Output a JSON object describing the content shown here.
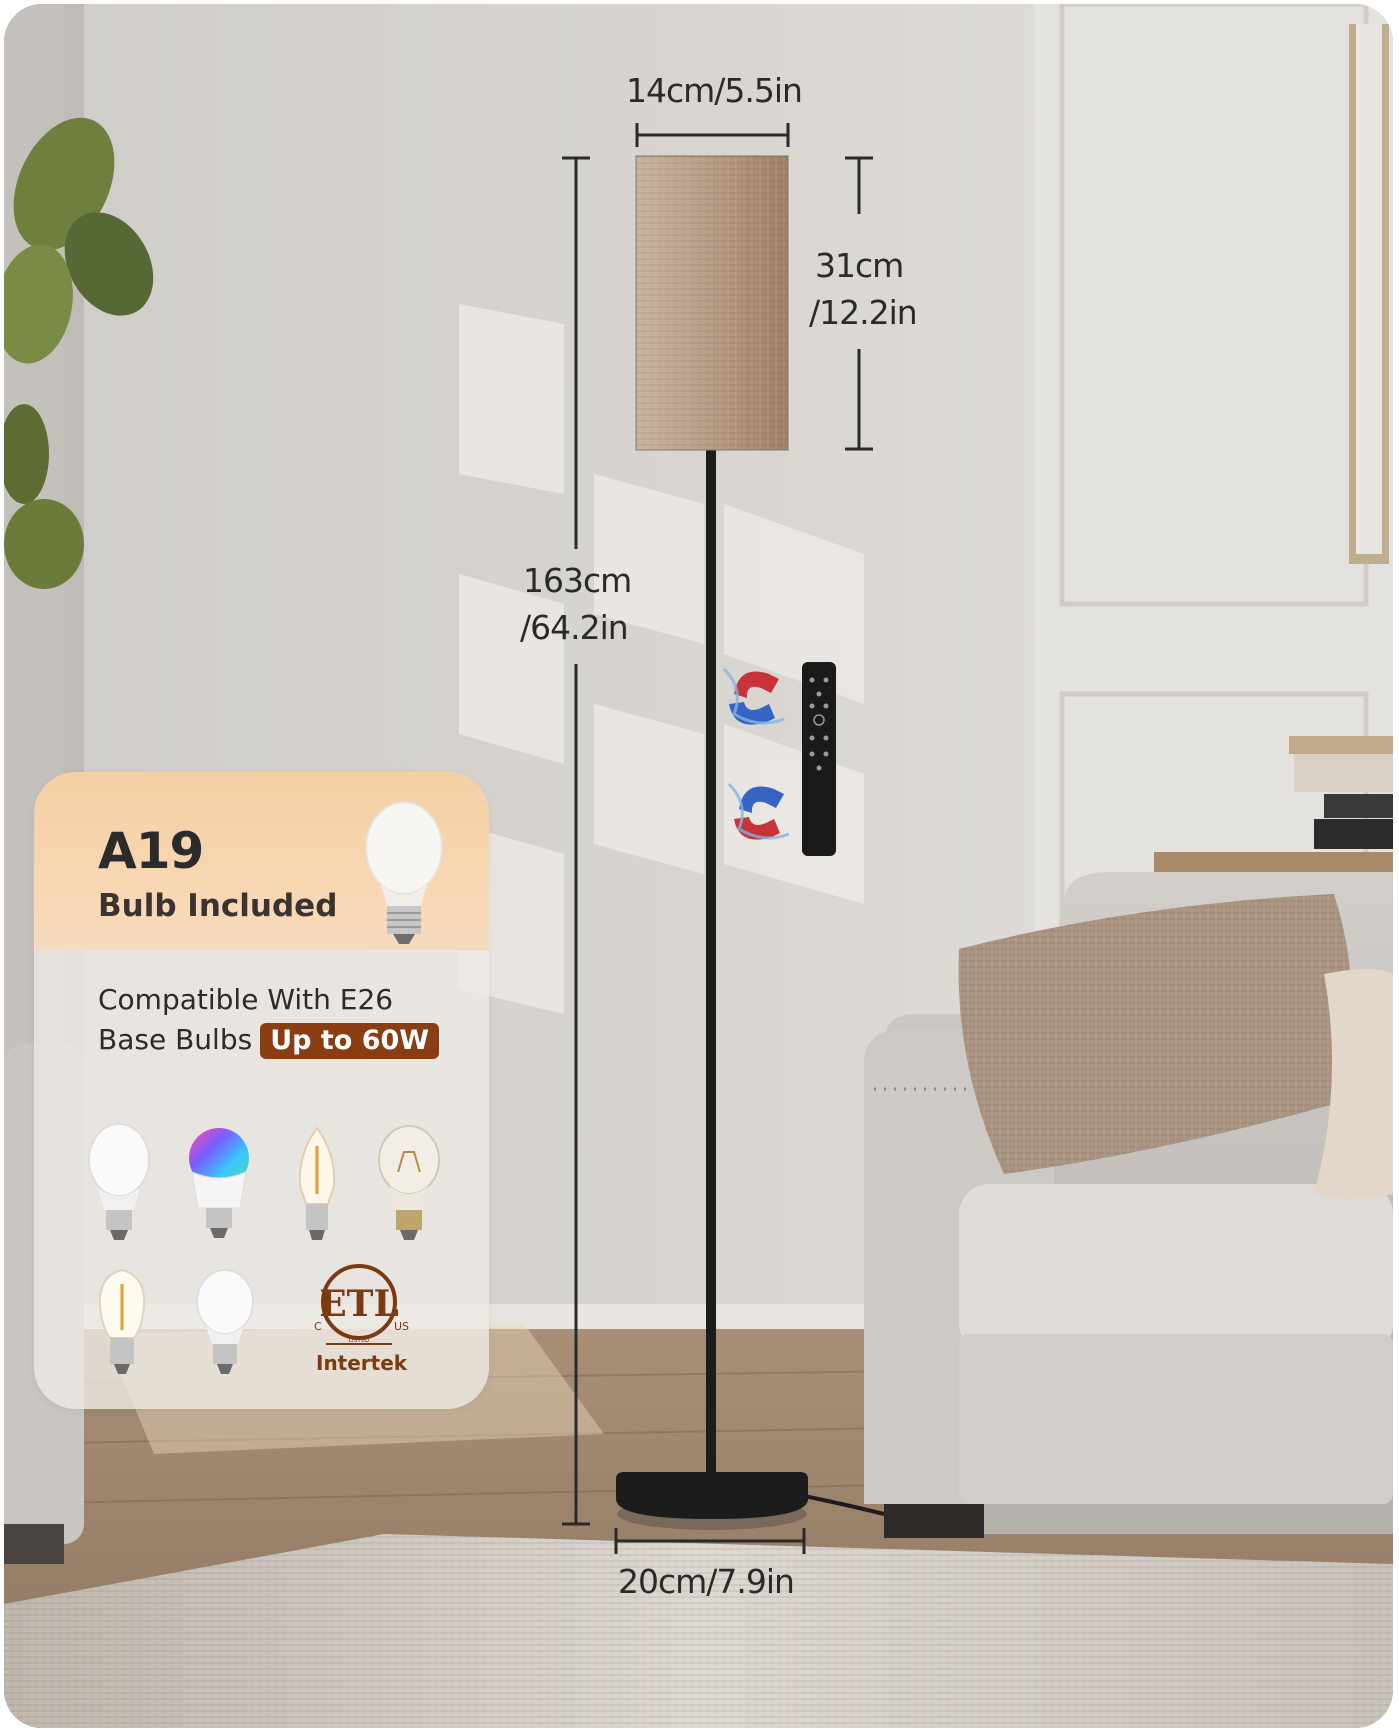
{
  "dimensions": {
    "shade_width": "14cm/5.5in",
    "shade_height_cm": "31cm",
    "shade_height_in": "/12.2in",
    "total_height_cm": "163cm",
    "total_height_in": "/64.2in",
    "base_diameter": "20cm/7.9in"
  },
  "card": {
    "model": "A19",
    "subtitle": "Bulb Included",
    "compat_line1": "Compatible With E26",
    "compat_line2": "Base Bulbs",
    "wattage_badge": "Up to 60W",
    "certification_mark": "ETL",
    "certification_small_left": "C",
    "certification_small_right": "US",
    "certification_listed": "LISTED",
    "certifier": "Intertek"
  },
  "colors": {
    "card_accent": "#f5cfa3",
    "badge_background": "#8a3c12",
    "shade": "#b59a80",
    "lamp_metal": "#1c1c1c"
  },
  "icons": [
    "bulb-icon",
    "led-bulb-icon",
    "rgb-bulb-icon",
    "filament-candle-bulb-icon",
    "incandescent-bulb-icon",
    "filament-bulb-icon",
    "globe-bulb-icon",
    "etl-listed-icon",
    "magnet-icon",
    "remote-control-icon"
  ]
}
